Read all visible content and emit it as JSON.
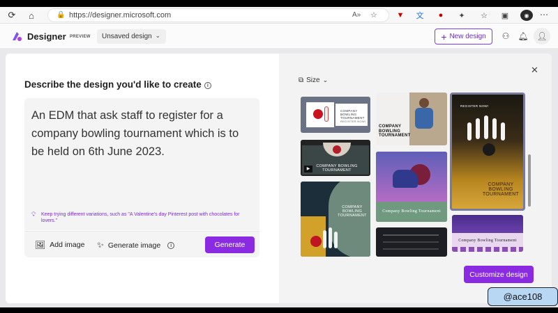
{
  "browser": {
    "url": "https://designer.microsoft.com"
  },
  "app": {
    "name": "Designer",
    "badge": "PREVIEW",
    "doc_name": "Unsaved design",
    "new_design_label": "New design"
  },
  "dialog": {
    "heading": "Describe the design you'd like to create",
    "prompt_text": "An EDM that ask staff to register for a company bowling tournament which is to be held on 6th June 2023.",
    "hint": "Keep trying different variations, such as \"A Valentine's day Pinterest post with chocolates for lovers.\"",
    "add_image_label": "Add image",
    "generate_image_label": "Generate image",
    "generate_label": "Generate",
    "size_label": "Size",
    "customize_label": "Customize design"
  },
  "thumbnails": {
    "t1_title": "COMPANY BOWLING TOURNAMENT",
    "t1_sub": "REGISTER NOW!",
    "t2_title": "COMPANY BOWLING TOURNAMENT",
    "t3_title": "COMPANY BOWLING TOURNAMENT",
    "t4_title": "Company Bowling Tournament",
    "t5_title": "COMPANY BOWLING TOURNAMENT",
    "t6_title": "REGISTER NOW!",
    "t6_sub": "COMPANY BOWLING TOURNAMENT",
    "t7_title": "Company Bowling Tournament"
  },
  "watermark": "@ace108",
  "colors": {
    "accent": "#8a2be2",
    "accent_text": "#6b2bd9",
    "selected_border": "#7a7a9a"
  }
}
